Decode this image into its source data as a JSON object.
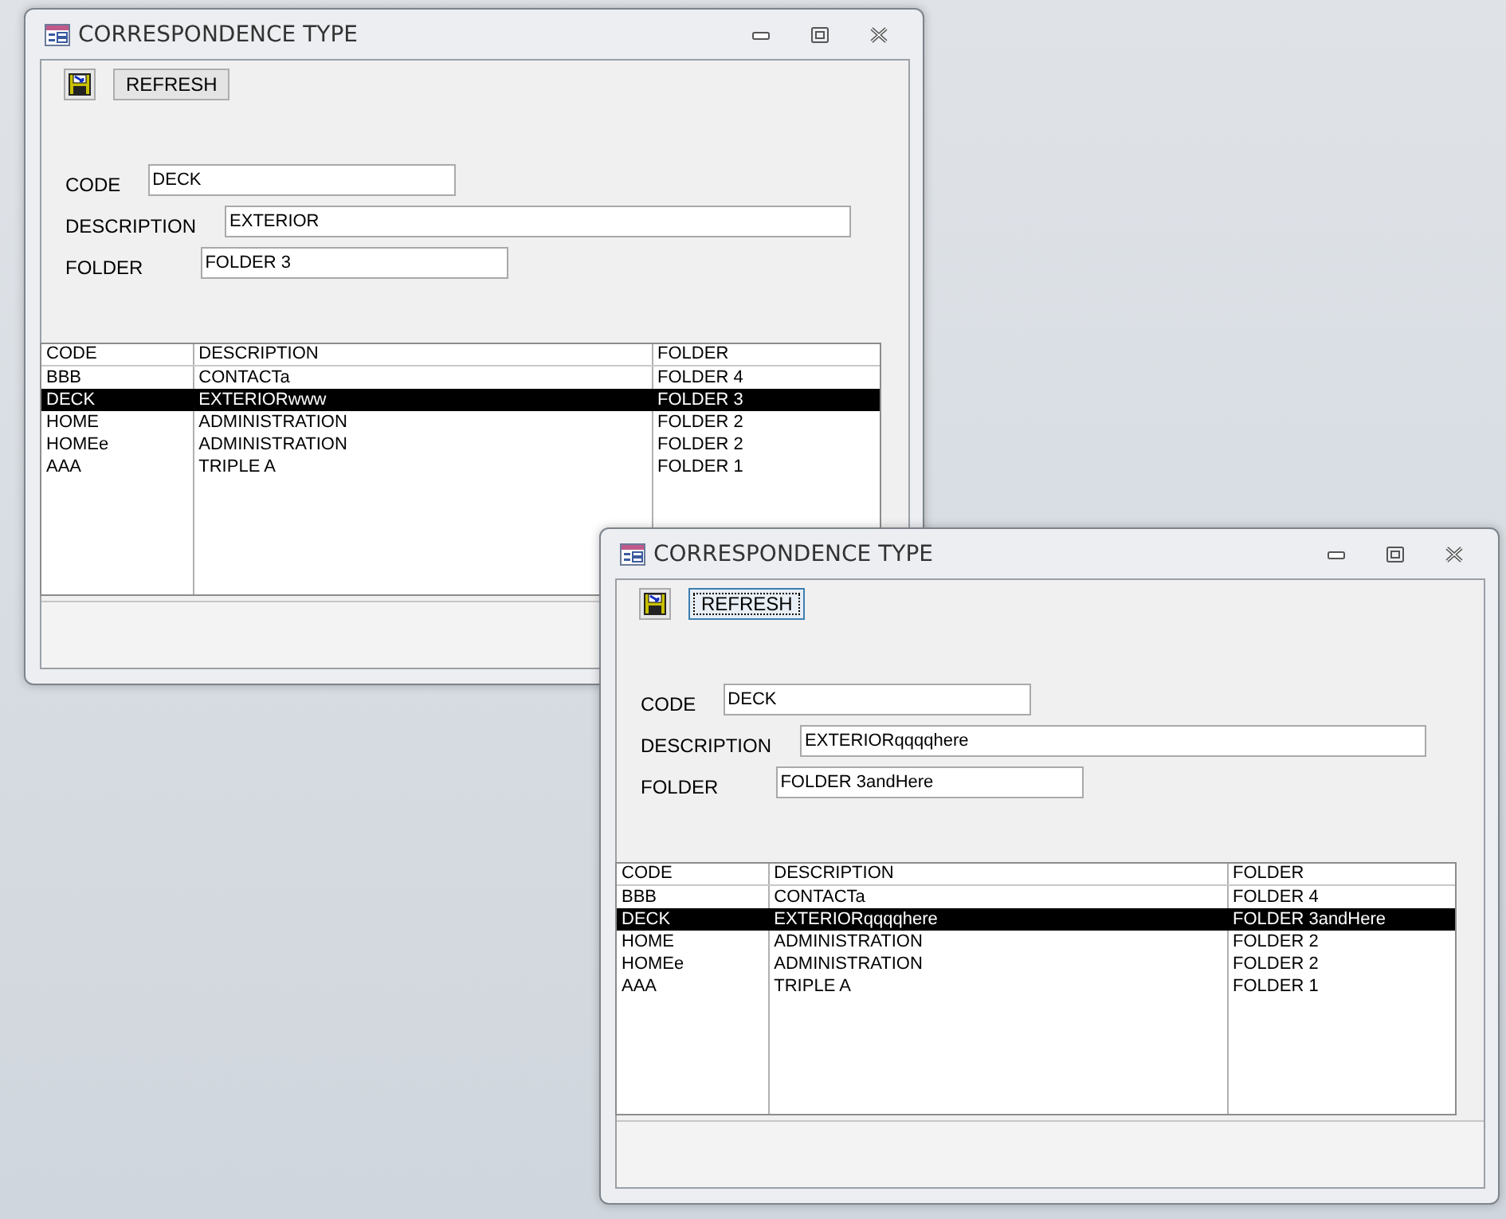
{
  "windows": [
    {
      "title": "CORRESPONDENCE TYPE",
      "refresh": {
        "label": "REFRESH",
        "focused": false
      },
      "fields": [
        {
          "label": "CODE",
          "value": "DECK"
        },
        {
          "label": "DESCRIPTION",
          "value": "EXTERIOR"
        },
        {
          "label": "FOLDER",
          "value": "FOLDER 3"
        }
      ],
      "list": {
        "columns": [
          "CODE",
          "DESCRIPTION",
          "FOLDER"
        ],
        "rows": [
          {
            "cells": [
              "BBB",
              "CONTACTa",
              "FOLDER 4"
            ],
            "selected": false
          },
          {
            "cells": [
              "DECK",
              "EXTERIORwww",
              "FOLDER 3"
            ],
            "selected": true
          },
          {
            "cells": [
              "HOME",
              "ADMINISTRATION",
              "FOLDER 2"
            ],
            "selected": false
          },
          {
            "cells": [
              "HOMEe",
              "ADMINISTRATION",
              "FOLDER 2"
            ],
            "selected": false
          },
          {
            "cells": [
              "AAA",
              "TRIPLE A",
              "FOLDER 1"
            ],
            "selected": false
          }
        ]
      }
    },
    {
      "title": "CORRESPONDENCE TYPE",
      "refresh": {
        "label": "REFRESH",
        "focused": true
      },
      "fields": [
        {
          "label": "CODE",
          "value": "DECK"
        },
        {
          "label": "DESCRIPTION",
          "value": "EXTERIORqqqqhere"
        },
        {
          "label": "FOLDER",
          "value": "FOLDER 3andHere"
        }
      ],
      "list": {
        "columns": [
          "CODE",
          "DESCRIPTION",
          "FOLDER"
        ],
        "rows": [
          {
            "cells": [
              "BBB",
              "CONTACTa",
              "FOLDER 4"
            ],
            "selected": false
          },
          {
            "cells": [
              "DECK",
              "EXTERIORqqqqhere",
              "FOLDER 3andHere"
            ],
            "selected": true
          },
          {
            "cells": [
              "HOME",
              "ADMINISTRATION",
              "FOLDER 2"
            ],
            "selected": false
          },
          {
            "cells": [
              "HOMEe",
              "ADMINISTRATION",
              "FOLDER 2"
            ],
            "selected": false
          },
          {
            "cells": [
              "AAA",
              "TRIPLE A",
              "FOLDER 1"
            ],
            "selected": false
          }
        ]
      }
    }
  ]
}
